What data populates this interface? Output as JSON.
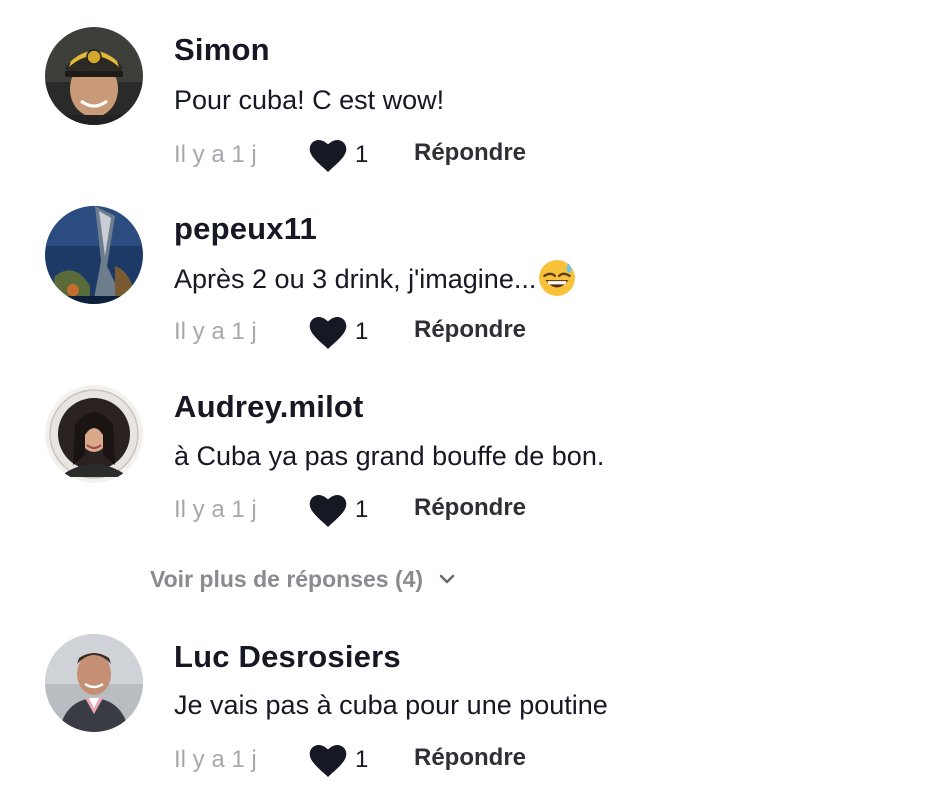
{
  "comments": [
    {
      "username": "Simon",
      "text": "Pour cuba! C est wow!",
      "time": "Il y a 1 j",
      "likes": "1",
      "reply_label": "Répondre"
    },
    {
      "username": "pepeux11",
      "text": "Après 2 ou 3 drink, j'imagine...",
      "emoji": "grinning-face-with-sweat",
      "time": "Il y a 1 j",
      "likes": "1",
      "reply_label": "Répondre"
    },
    {
      "username": "Audrey.milot",
      "text": "à Cuba ya pas grand bouffe de bon.",
      "time": "Il y a 1 j",
      "likes": "1",
      "reply_label": "Répondre"
    },
    {
      "username": "Luc Desrosiers",
      "text": "Je vais pas à cuba pour une poutine",
      "time": "Il y a 1 j",
      "likes": "1",
      "reply_label": "Répondre"
    }
  ],
  "more_replies": {
    "label": "Voir plus de réponses (4)",
    "icon": "chevron-down-icon"
  },
  "colors": {
    "text_primary": "#161823",
    "text_secondary": "#a7a8ad",
    "more_replies": "#8a8b91"
  }
}
